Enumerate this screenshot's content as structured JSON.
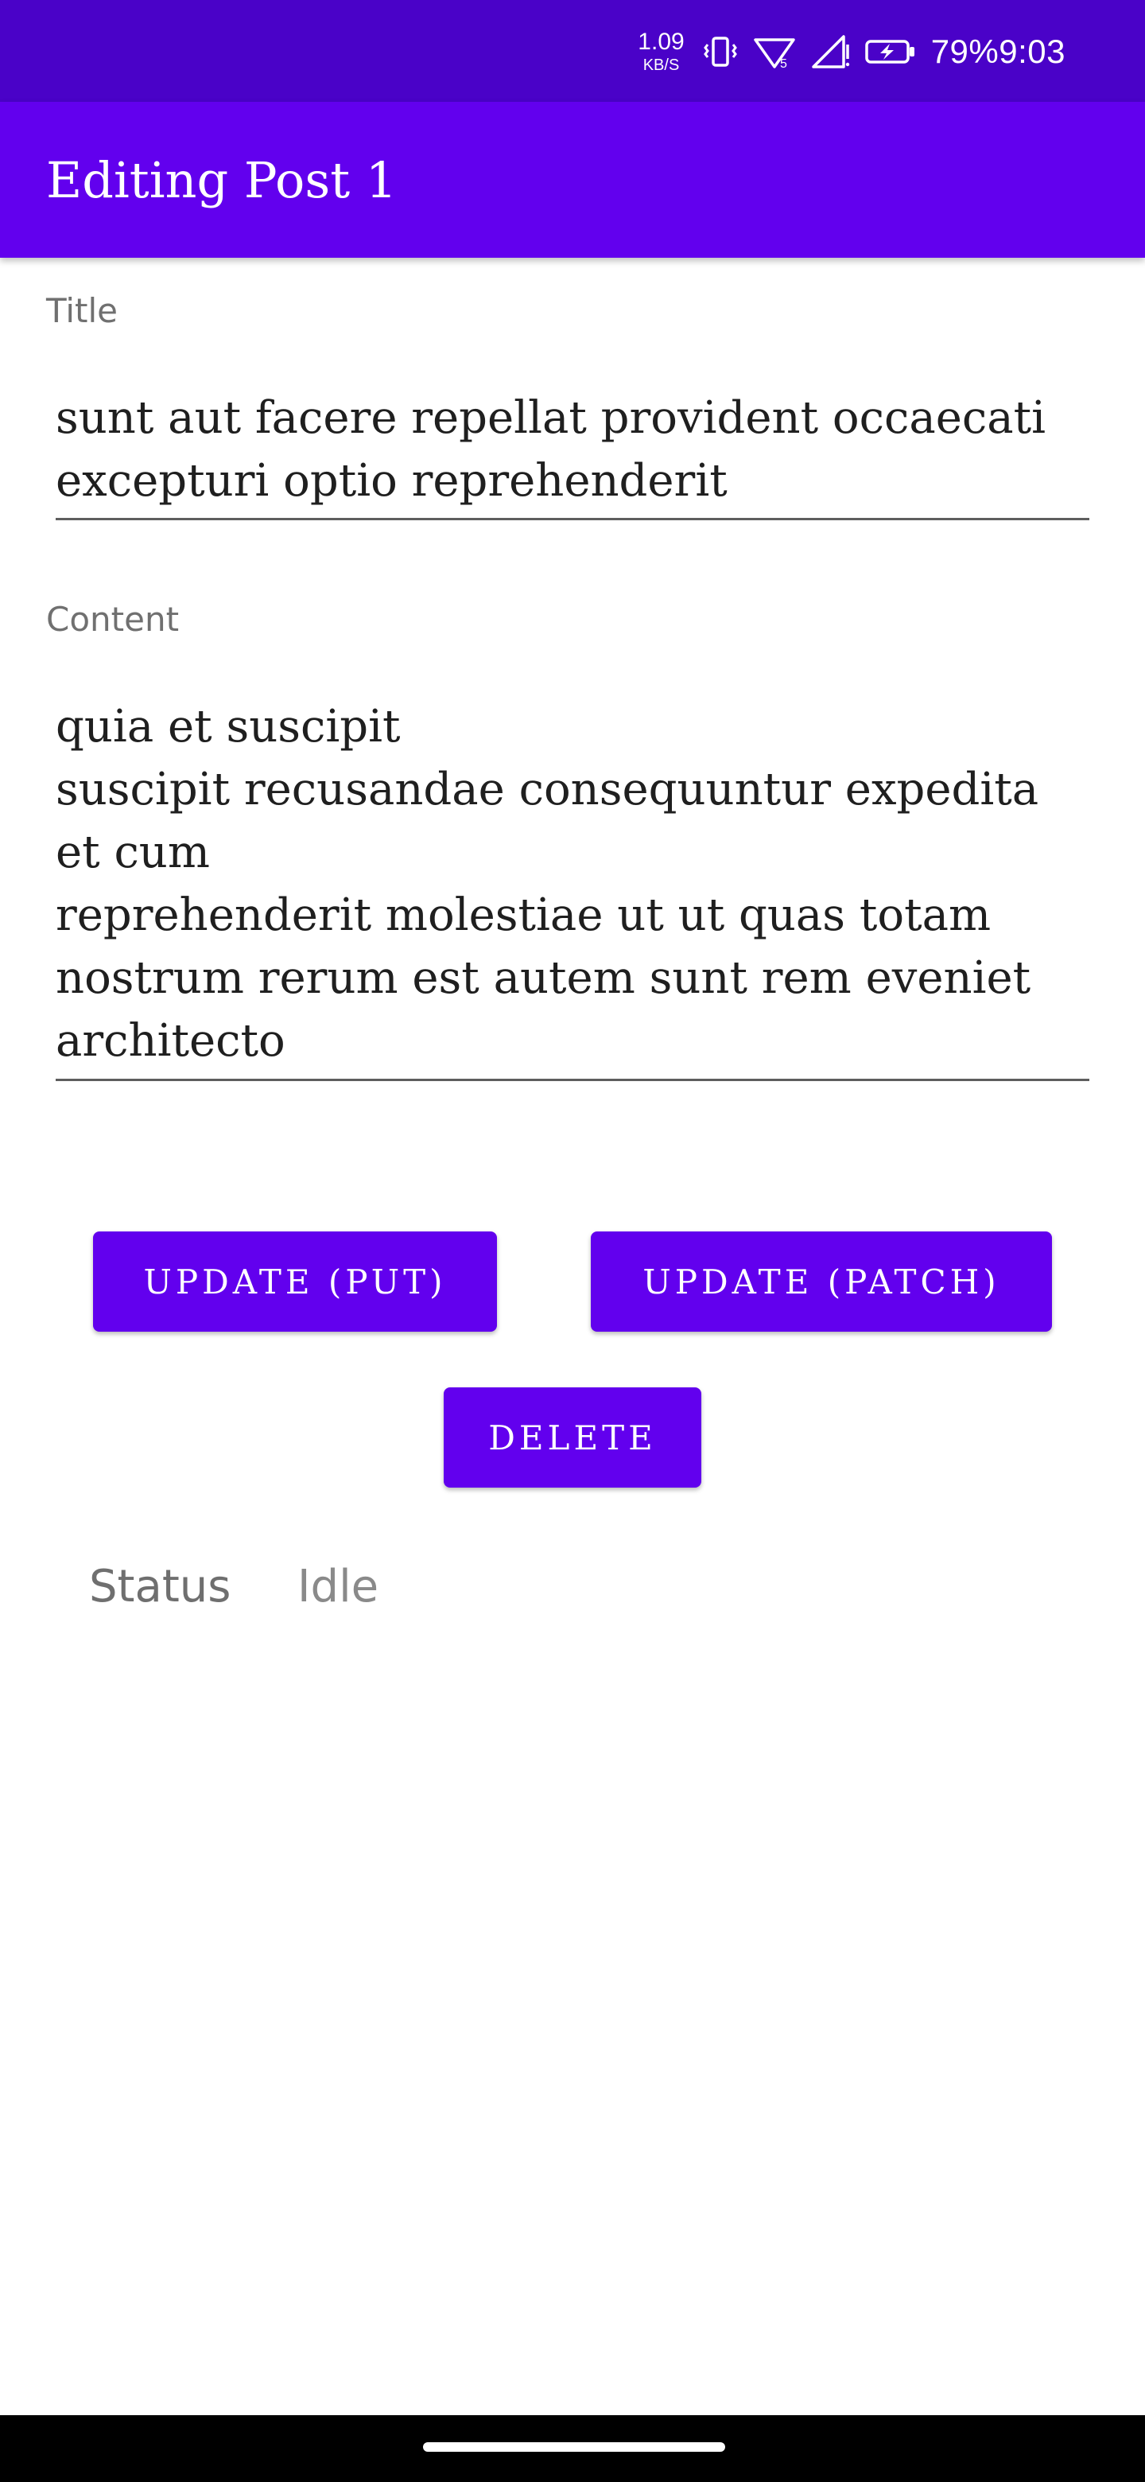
{
  "status_bar": {
    "net_speed": "1.09",
    "net_unit": "KB/S",
    "battery_percent": "79%",
    "time": "9:03",
    "icons": [
      "vibrate-icon",
      "wifi-icon",
      "signal-icon",
      "battery-charging-icon"
    ]
  },
  "app_bar": {
    "title": "Editing Post 1"
  },
  "form": {
    "title_label": "Title",
    "title_value": "sunt aut facere repellat provident occaecati excepturi optio reprehenderit",
    "content_label": "Content",
    "content_value": "quia et suscipit\nsuscipit recusandae consequuntur expedita et cum\nreprehenderit molestiae ut ut quas totam\nnostrum rerum est autem sunt rem eveniet architecto"
  },
  "buttons": {
    "update_put": "Update (PUT)",
    "update_patch": "Update (PATCH)",
    "delete": "Delete"
  },
  "status": {
    "label": "Status",
    "value": "Idle"
  },
  "colors": {
    "status_bar": "#4a02c8",
    "primary": "#6200ee",
    "on_primary": "#ffffff"
  }
}
